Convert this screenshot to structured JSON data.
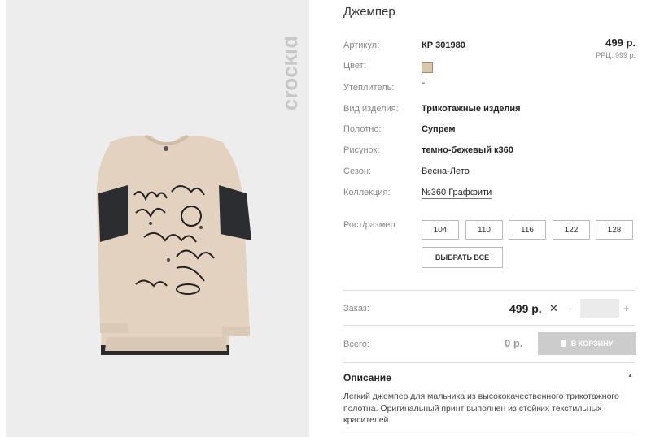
{
  "product": {
    "title": "Джемпер",
    "price": "499 р.",
    "rrp": "РРЦ: 999 р."
  },
  "brand_logo_text": "crockid",
  "attributes": [
    {
      "label": "Артикул:",
      "value": "КР 301980"
    },
    {
      "label": "Цвет:",
      "value": ""
    },
    {
      "label": "Утеплитель:",
      "value": "\""
    },
    {
      "label": "Вид изделия:",
      "value": "Трикотажные изделия"
    },
    {
      "label": "Полотно:",
      "value": "Супрем"
    },
    {
      "label": "Рисунок:",
      "value": "темно-бежевый к360"
    },
    {
      "label": "Сезон:",
      "value": "Весна-Лето"
    },
    {
      "label": "Коллекция:",
      "value": "№360 Граффити"
    }
  ],
  "swatch_color": "#d9c6ac",
  "sizes": {
    "label": "Рост/размер:",
    "options": [
      "104",
      "110",
      "116",
      "122",
      "128"
    ],
    "select_all": "ВЫБРАТЬ ВСЕ"
  },
  "order": {
    "label": "Заказ:",
    "price": "499 р.",
    "times": "✕",
    "minus": "—",
    "plus": "+",
    "quantity": ""
  },
  "total": {
    "label": "Всего:",
    "value": "0 р.",
    "cart_button": "В КОРЗИНУ"
  },
  "description": {
    "title": "Описание",
    "text": "Легкий джемпер для мальчика из высококачественного трикотажного полотна. Оригинальный принт выполнен из стойких текстильных красителей."
  },
  "colors": {
    "garment": "#e3d2bf",
    "sleeve_band": "#2b2d30",
    "photo_bg": "#ededed",
    "logo": "#c8c8c8",
    "cart_button": "#cccccc"
  }
}
